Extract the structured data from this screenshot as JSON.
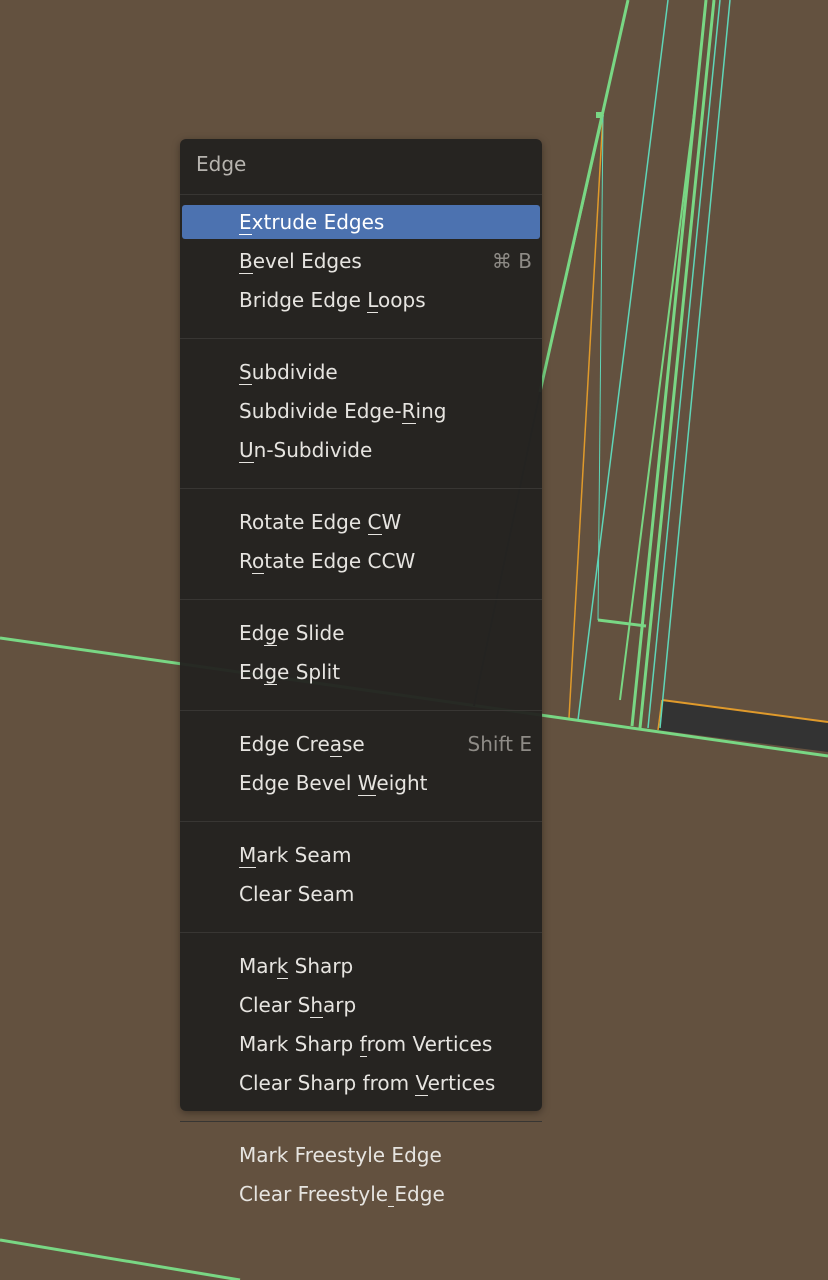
{
  "colors": {
    "viewport_bg": "#63513f",
    "menu_bg": "#232220",
    "highlight": "#4c72b0",
    "edge_green": "#79d784",
    "edge_cyan": "#5fd6b8",
    "edge_orange": "#e09a2b",
    "face_dark": "#333333"
  },
  "menu": {
    "title": "Edge",
    "groups": [
      [
        {
          "label": "Extrude Edges",
          "mnemonic_index": 0,
          "shortcut": "",
          "active": true
        },
        {
          "label": "Bevel Edges",
          "mnemonic_index": 0,
          "shortcut": "⌘ B",
          "active": false
        },
        {
          "label": "Bridge Edge Loops",
          "mnemonic_index": 12,
          "shortcut": "",
          "active": false
        }
      ],
      [
        {
          "label": "Subdivide",
          "mnemonic_index": 0,
          "shortcut": "",
          "active": false
        },
        {
          "label": "Subdivide Edge-Ring",
          "mnemonic_index": 15,
          "shortcut": "",
          "active": false
        },
        {
          "label": "Un-Subdivide",
          "mnemonic_index": 0,
          "shortcut": "",
          "active": false
        }
      ],
      [
        {
          "label": "Rotate Edge CW",
          "mnemonic_index": 12,
          "shortcut": "",
          "active": false
        },
        {
          "label": "Rotate Edge CCW",
          "mnemonic_index": 1,
          "shortcut": "",
          "active": false
        }
      ],
      [
        {
          "label": "Edge Slide",
          "mnemonic_index": 2,
          "shortcut": "",
          "active": false
        },
        {
          "label": "Edge Split",
          "mnemonic_index": 2,
          "shortcut": "",
          "active": false
        }
      ],
      [
        {
          "label": "Edge Crease",
          "mnemonic_index": 8,
          "shortcut": "Shift E",
          "active": false
        },
        {
          "label": "Edge Bevel Weight",
          "mnemonic_index": 11,
          "shortcut": "",
          "active": false
        }
      ],
      [
        {
          "label": "Mark Seam",
          "mnemonic_index": 0,
          "shortcut": "",
          "active": false
        },
        {
          "label": "Clear Seam",
          "mnemonic_index": -1,
          "shortcut": "",
          "active": false
        }
      ],
      [
        {
          "label": "Mark Sharp",
          "mnemonic_index": 3,
          "shortcut": "",
          "active": false
        },
        {
          "label": "Clear Sharp",
          "mnemonic_index": 7,
          "shortcut": "",
          "active": false
        },
        {
          "label": "Mark Sharp from Vertices",
          "mnemonic_index": 11,
          "shortcut": "",
          "active": false
        },
        {
          "label": "Clear Sharp from Vertices",
          "mnemonic_index": 17,
          "shortcut": "",
          "active": false
        }
      ],
      [
        {
          "label": "Mark Freestyle Edge",
          "mnemonic_index": -1,
          "shortcut": "",
          "active": false
        },
        {
          "label": "Clear Freestyle Edge",
          "mnemonic_index": 15,
          "shortcut": "",
          "active": false
        }
      ]
    ]
  }
}
